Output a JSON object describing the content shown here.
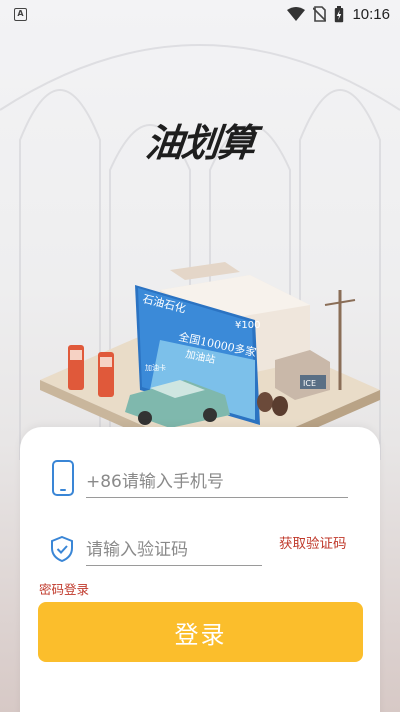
{
  "status_bar": {
    "notification_icon": "a-app-icon",
    "time": "10:16",
    "icons": [
      "wifi-icon",
      "no-sim-icon",
      "battery-charging-icon"
    ]
  },
  "logo": {
    "text": "油划算"
  },
  "illustration": {
    "sign_title": "石油石化",
    "banner_main": "全国10000多家",
    "banner_sub": "加油站",
    "banner_price": "¥100",
    "ice_label": "ICE",
    "card_label": "加油卡"
  },
  "login": {
    "phone_placeholder": "+86请输入手机号",
    "code_placeholder": "请输入验证码",
    "get_code_label": "获取验证码",
    "password_login_label": "密码登录",
    "login_button_label": "登录"
  },
  "colors": {
    "accent_blue": "#3a86d6",
    "link_red": "#c0392b",
    "button_yellow": "#fbbe2c"
  }
}
